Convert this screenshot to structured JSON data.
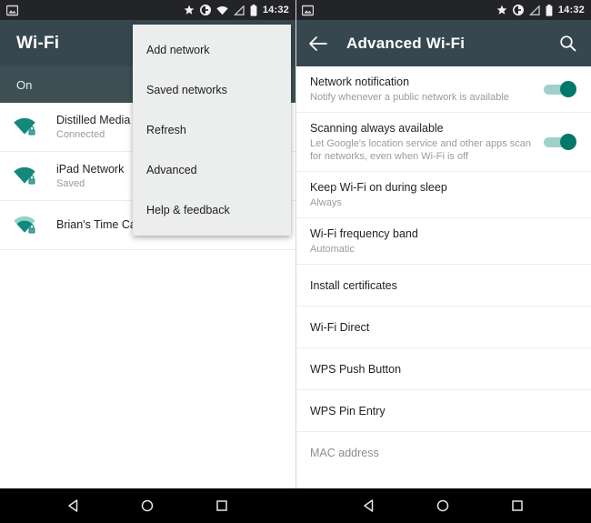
{
  "status_bar": {
    "left_panel": {
      "icons": [
        "image-icon",
        "star-icon",
        "do-not-disturb-icon",
        "wifi-icon",
        "signal-icon",
        "battery-icon"
      ],
      "time": "14:32"
    },
    "right_panel": {
      "icons": [
        "image-icon",
        "star-icon",
        "do-not-disturb-icon",
        "signal-icon",
        "battery-icon"
      ],
      "time": "14:32"
    }
  },
  "left_panel": {
    "toolbar": {
      "title": "Wi-Fi"
    },
    "switch_row": {
      "label": "On"
    },
    "networks": [
      {
        "name": "Distilled Media",
        "status": "Connected",
        "icon": "wifi-lock-icon",
        "strength": "full"
      },
      {
        "name": "iPad Network",
        "status": "Saved",
        "icon": "wifi-lock-icon",
        "strength": "full"
      },
      {
        "name": "Brian's Time Capsule",
        "status": "",
        "icon": "wifi-lock-icon",
        "strength": "weak"
      }
    ],
    "overflow_menu": {
      "items": [
        {
          "label": "Add network"
        },
        {
          "label": "Saved networks"
        },
        {
          "label": "Refresh"
        },
        {
          "label": "Advanced"
        },
        {
          "label": "Help & feedback"
        }
      ]
    }
  },
  "right_panel": {
    "toolbar": {
      "title": "Advanced Wi-Fi",
      "back_icon": "back-arrow-icon",
      "search_icon": "search-icon"
    },
    "settings": [
      {
        "title": "Network notification",
        "subtitle": "Notify whenever a public network is available",
        "control": "toggle",
        "toggle_on": true
      },
      {
        "title": "Scanning always available",
        "subtitle": "Let Google's location service and other apps scan for networks, even when Wi-Fi is off",
        "control": "toggle",
        "toggle_on": true
      },
      {
        "title": "Keep Wi-Fi on during sleep",
        "subtitle": "Always",
        "control": "none"
      },
      {
        "title": "Wi-Fi frequency band",
        "subtitle": "Automatic",
        "control": "none"
      },
      {
        "title": "Install certificates",
        "subtitle": "",
        "control": "none"
      },
      {
        "title": "Wi-Fi Direct",
        "subtitle": "",
        "control": "none"
      },
      {
        "title": "WPS Push Button",
        "subtitle": "",
        "control": "none"
      },
      {
        "title": "WPS Pin Entry",
        "subtitle": "",
        "control": "none"
      },
      {
        "title": "MAC address",
        "subtitle": "",
        "control": "none",
        "partial": true
      }
    ]
  },
  "nav_bar": {
    "buttons": [
      {
        "name": "back-button",
        "icon": "triangle-back-icon"
      },
      {
        "name": "home-button",
        "icon": "circle-home-icon"
      },
      {
        "name": "recents-button",
        "icon": "square-recents-icon"
      }
    ]
  },
  "colors": {
    "toolbar": "#37474f",
    "status_bar": "#232427",
    "accent_teal": "#00897b",
    "toggle_thumb": "#00796b",
    "menu_bg": "#eceded"
  }
}
